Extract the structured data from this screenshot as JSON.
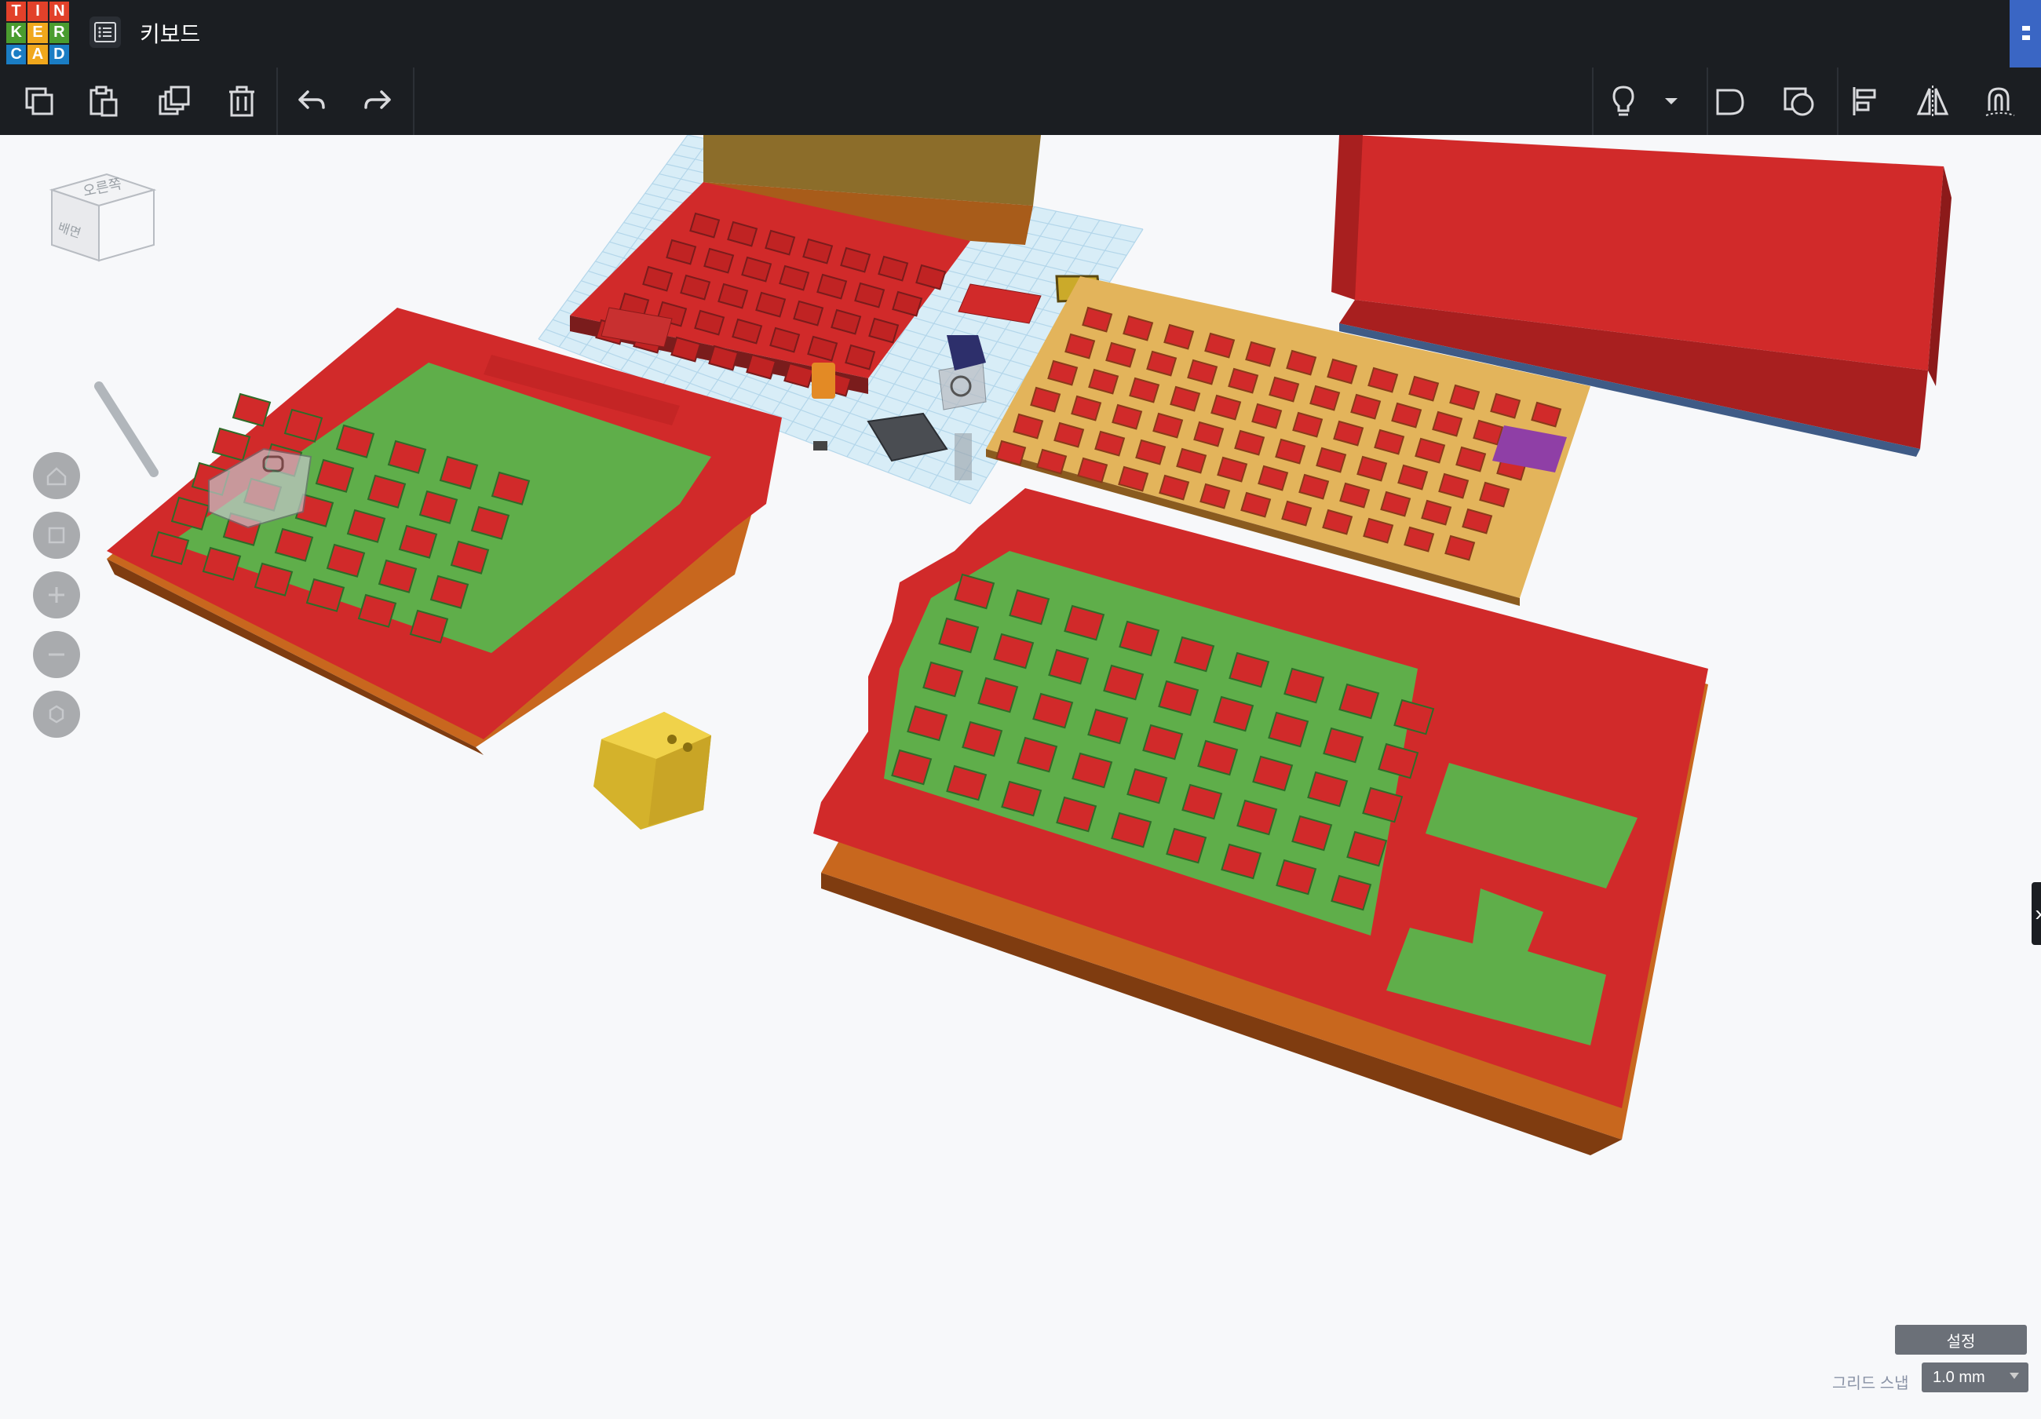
{
  "app": {
    "logo_letters": [
      "T",
      "I",
      "N",
      "K",
      "E",
      "R",
      "C",
      "A",
      "D"
    ],
    "logo_colors": [
      "#e2412a",
      "#e2412a",
      "#e2412a",
      "#4a9c2f",
      "#f0a71c",
      "#4a9c2f",
      "#1a7dc4",
      "#f0a71c",
      "#1a7dc4"
    ],
    "document_title": "키보드"
  },
  "toolbar": {
    "left_tools": [
      {
        "name": "copy-button",
        "icon": "copy-icon"
      },
      {
        "name": "paste-button",
        "icon": "paste-icon"
      },
      {
        "name": "duplicate-button",
        "icon": "duplicate-icon"
      },
      {
        "name": "delete-button",
        "icon": "trash-icon"
      },
      {
        "name": "undo-button",
        "icon": "undo-icon"
      },
      {
        "name": "redo-button",
        "icon": "redo-icon"
      }
    ],
    "right_tools": [
      {
        "name": "lightbulb-button",
        "icon": "lightbulb-icon"
      },
      {
        "name": "lightbulb-dropdown",
        "icon": "caret-down-icon"
      },
      {
        "name": "group-button",
        "icon": "group-icon"
      },
      {
        "name": "ungroup-button",
        "icon": "ungroup-icon"
      },
      {
        "name": "align-button",
        "icon": "align-icon"
      },
      {
        "name": "mirror-button",
        "icon": "mirror-icon"
      },
      {
        "name": "cruise-button",
        "icon": "magnet-icon"
      }
    ]
  },
  "view_cube": {
    "top_label": "오른쪽",
    "front_label": "배면"
  },
  "view_controls": [
    {
      "name": "home-view-button",
      "icon": "home-icon"
    },
    {
      "name": "fit-view-button",
      "icon": "fit-icon"
    },
    {
      "name": "zoom-in-button",
      "icon": "plus-icon"
    },
    {
      "name": "zoom-out-button",
      "icon": "minus-icon"
    },
    {
      "name": "ortho-view-button",
      "icon": "ortho-icon"
    }
  ],
  "settings": {
    "settings_label": "설정",
    "grid_snap_label": "그리드 스냅",
    "grid_snap_value": "1.0 mm"
  },
  "colors": {
    "case_red": "#d32f2f",
    "plate_green": "#5fae4a",
    "base_orange": "#c8671e",
    "pcb_yellow": "#e3b45b",
    "workplane": "#d6ecf7",
    "accent_blue": "#3a66c4"
  }
}
